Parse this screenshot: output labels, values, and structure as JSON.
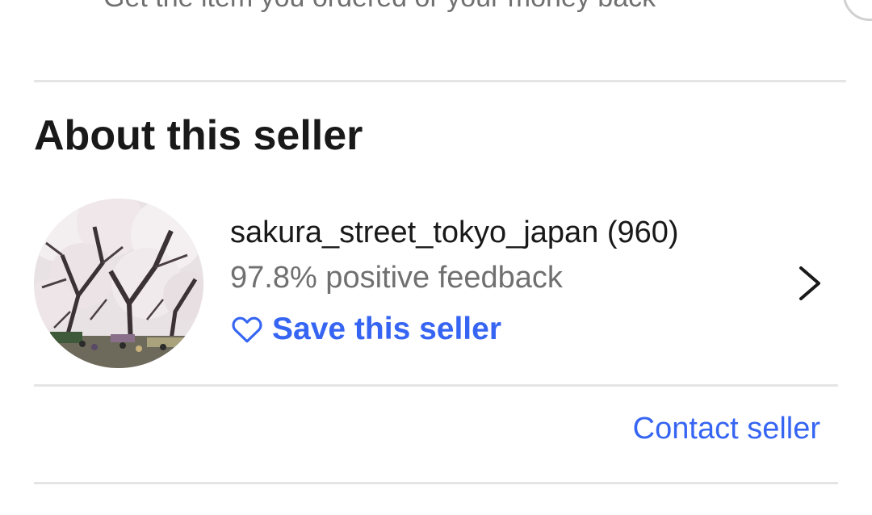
{
  "guarantee": {
    "text": "Get the item you ordered or your money back"
  },
  "about_seller": {
    "title": "About this seller",
    "seller_name": "sakura_street_tokyo_japan (960)",
    "feedback": "97.8% positive feedback",
    "save_label": "Save this seller",
    "contact_label": "Contact seller"
  },
  "icons": {
    "save": "heart-icon",
    "open": "chevron-right-icon"
  },
  "colors": {
    "link": "#3665f3",
    "text": "#191919",
    "muted": "#707070",
    "divider": "#e5e5e5"
  }
}
